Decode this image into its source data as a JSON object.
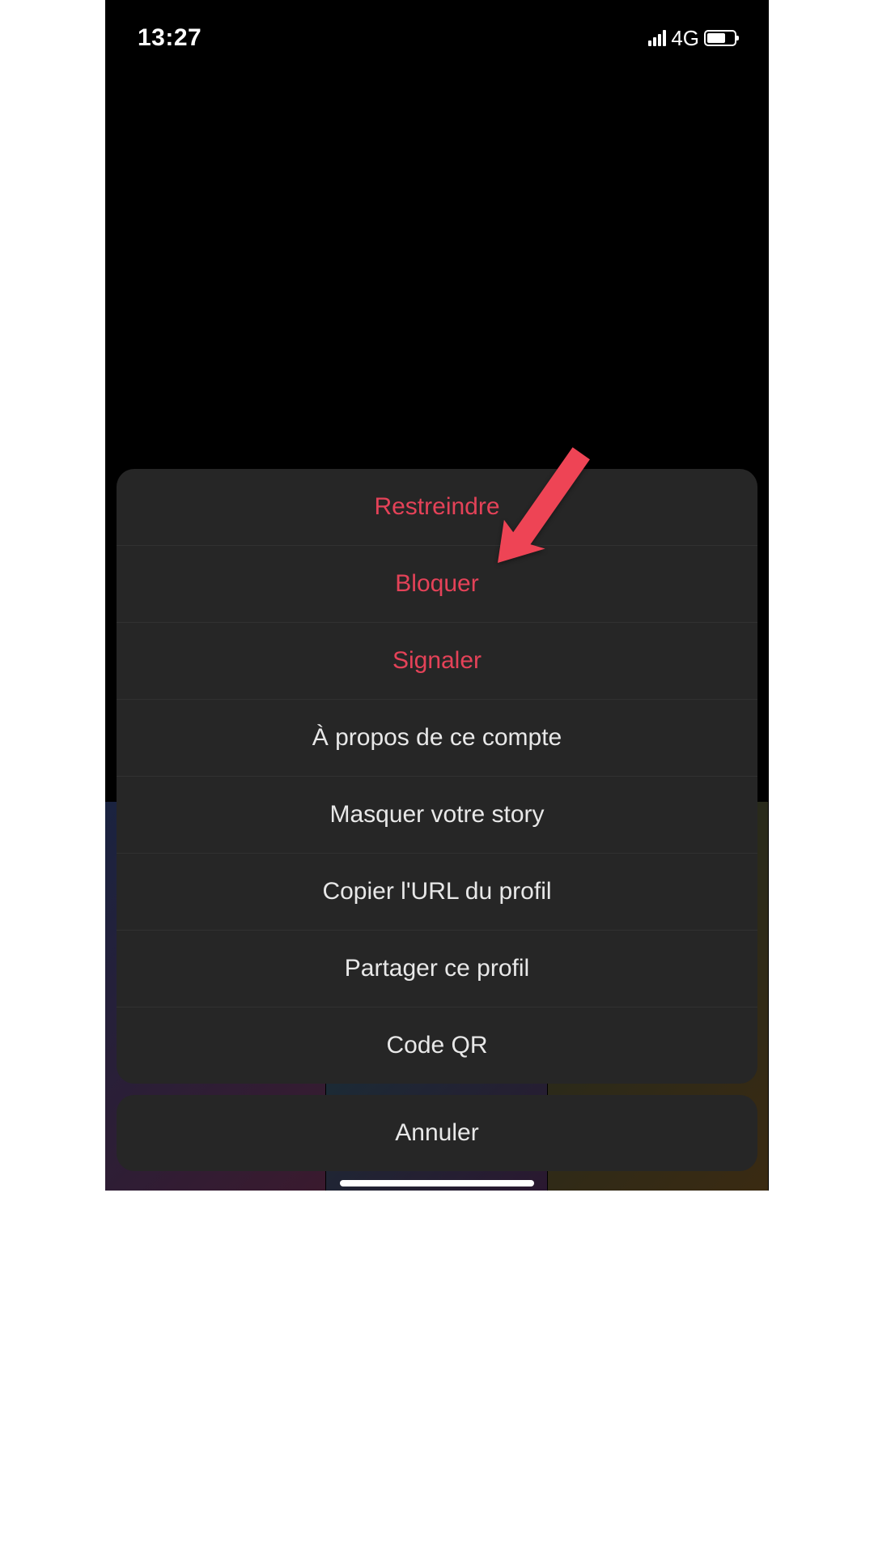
{
  "status_bar": {
    "time": "13:27",
    "network_label": "4G"
  },
  "action_sheet": {
    "items": [
      {
        "label": "Restreindre",
        "destructive": true,
        "name": "option-restrict"
      },
      {
        "label": "Bloquer",
        "destructive": true,
        "name": "option-block"
      },
      {
        "label": "Signaler",
        "destructive": true,
        "name": "option-report"
      },
      {
        "label": "À propos de ce compte",
        "destructive": false,
        "name": "option-about-account"
      },
      {
        "label": "Masquer votre story",
        "destructive": false,
        "name": "option-hide-story"
      },
      {
        "label": "Copier l'URL du profil",
        "destructive": false,
        "name": "option-copy-url"
      },
      {
        "label": "Partager ce profil",
        "destructive": false,
        "name": "option-share-profile"
      },
      {
        "label": "Code QR",
        "destructive": false,
        "name": "option-qr-code"
      }
    ],
    "cancel_label": "Annuler"
  },
  "annotation": {
    "arrow_color": "#ee4455",
    "points_to": "option-block"
  }
}
